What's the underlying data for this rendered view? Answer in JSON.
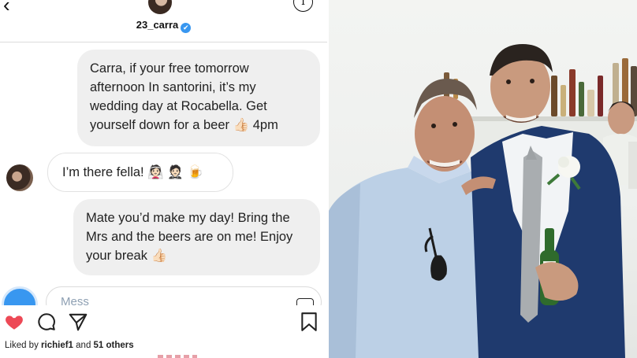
{
  "dm": {
    "username": "23_carra",
    "verified_mark": "✔",
    "back_glyph": "‹",
    "info_glyph": "i",
    "messages": [
      {
        "direction": "outgoing",
        "text": "Carra, if your free tomorrow afternoon In santorini, it’s my wedding day at Rocabella. Get yourself down for a beer 👍🏻 4pm"
      },
      {
        "direction": "incoming",
        "text": "I’m there fella! 👰🏻 🤵🏻 🍺"
      },
      {
        "direction": "outgoing",
        "text": "Mate you’d make my day! Bring the Mrs and the beers are on me! Enjoy your break 👍🏻"
      }
    ],
    "composer": {
      "placeholder": "Mess",
      "icons": [
        "camera-icon",
        "gallery-icon",
        "heart-icon"
      ]
    }
  },
  "post": {
    "actions": [
      "like-icon",
      "comment-icon",
      "share-icon",
      "save-icon"
    ],
    "like_color": "#ed4956",
    "likes_prefix": "Liked by ",
    "likes_user": "richief1",
    "likes_middle": " and ",
    "likes_count": "51 others"
  },
  "colors": {
    "accent": "#3897f0",
    "outgoing_bubble": "#efefef"
  }
}
